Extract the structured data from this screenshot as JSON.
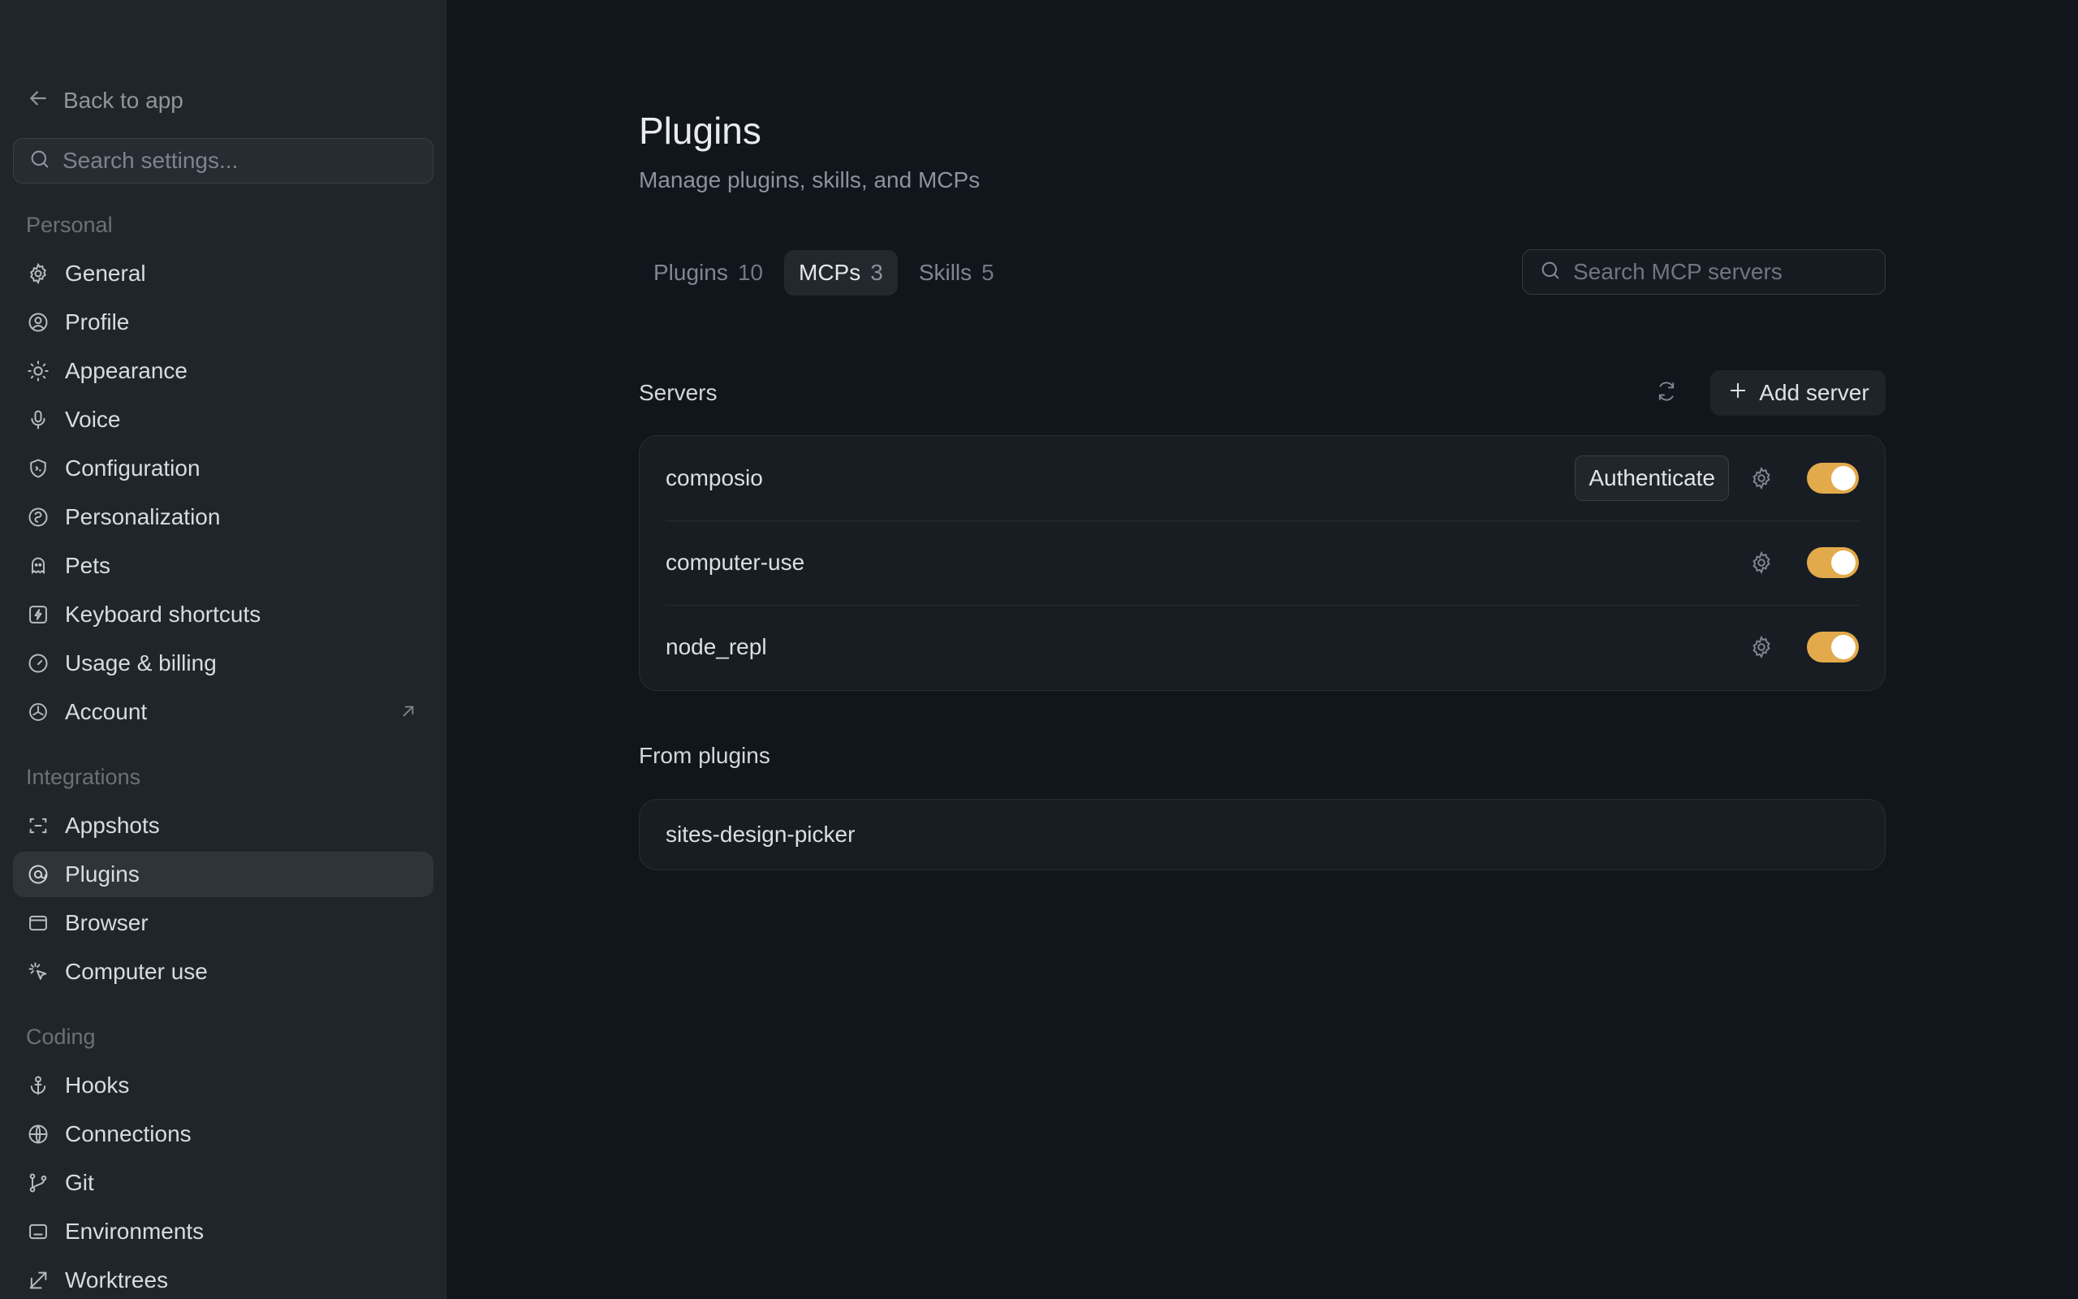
{
  "sidebar": {
    "back_label": "Back to app",
    "search_placeholder": "Search settings...",
    "sections": {
      "personal": "Personal",
      "integrations": "Integrations",
      "coding": "Coding"
    },
    "items": {
      "general": "General",
      "profile": "Profile",
      "appearance": "Appearance",
      "voice": "Voice",
      "configuration": "Configuration",
      "personalization": "Personalization",
      "pets": "Pets",
      "keyboard_shortcuts": "Keyboard shortcuts",
      "usage_billing": "Usage & billing",
      "account": "Account",
      "appshots": "Appshots",
      "plugins": "Plugins",
      "browser": "Browser",
      "computer_use": "Computer use",
      "hooks": "Hooks",
      "connections": "Connections",
      "git": "Git",
      "environments": "Environments",
      "worktrees": "Worktrees"
    },
    "active_item": "plugins"
  },
  "page": {
    "title": "Plugins",
    "subtitle": "Manage plugins, skills, and MCPs"
  },
  "tabs": [
    {
      "label": "Plugins",
      "count": "10"
    },
    {
      "label": "MCPs",
      "count": "3"
    },
    {
      "label": "Skills",
      "count": "5"
    }
  ],
  "active_tab": "MCPs",
  "search": {
    "placeholder": "Search MCP servers"
  },
  "servers": {
    "heading": "Servers",
    "add_label": "Add server",
    "items": [
      {
        "name": "composio",
        "auth_label": "Authenticate",
        "enabled": true
      },
      {
        "name": "computer-use",
        "enabled": true
      },
      {
        "name": "node_repl",
        "enabled": true
      }
    ]
  },
  "from_plugins": {
    "heading": "From plugins",
    "items": [
      {
        "name": "sites-design-picker"
      }
    ]
  },
  "colors": {
    "accent": "#e3aa4b",
    "background": "#11151c",
    "sidebar": "#1f2529"
  }
}
